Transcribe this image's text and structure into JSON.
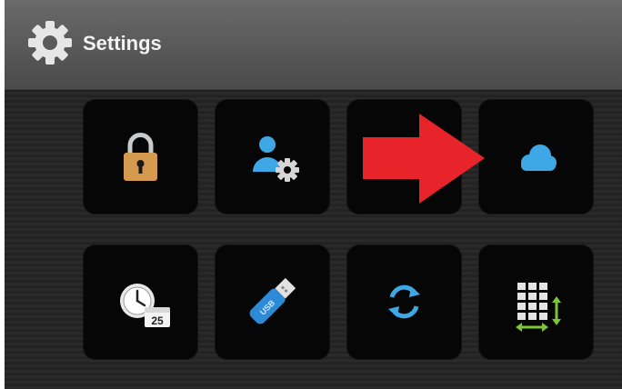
{
  "header": {
    "title": "Settings",
    "icon": "gear-icon"
  },
  "tiles": [
    {
      "name": "tile-security",
      "icon": "padlock-icon"
    },
    {
      "name": "tile-user-settings",
      "icon": "user-gear-icon"
    },
    {
      "name": "tile-empty",
      "icon": ""
    },
    {
      "name": "tile-cloud",
      "icon": "cloud-icon"
    },
    {
      "name": "tile-date-time",
      "icon": "clock-calendar-icon",
      "calendar_day": "25"
    },
    {
      "name": "tile-usb",
      "icon": "usb-drive-icon",
      "usb_label": "USB"
    },
    {
      "name": "tile-sync",
      "icon": "sync-icon"
    },
    {
      "name": "tile-display-size",
      "icon": "grid-resize-icon"
    }
  ],
  "annotation": {
    "icon": "red-arrow-icon",
    "color": "#e8232a"
  },
  "colors": {
    "header_bg": "#5a5a5a",
    "tile_bg": "#060606",
    "accent_blue": "#3ea7e6",
    "padlock": "#d69a4f",
    "resize_green": "#7cc63e"
  }
}
